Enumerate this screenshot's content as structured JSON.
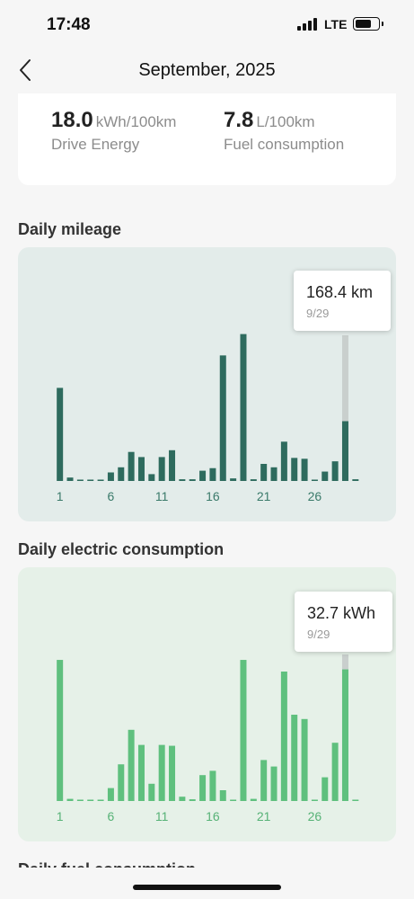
{
  "status_bar": {
    "time": "17:48",
    "network": "LTE"
  },
  "nav": {
    "title": "September, 2025",
    "back_icon": "chevron-left-icon"
  },
  "summary": {
    "drive_energy": {
      "value": "18.0",
      "unit": "kWh/100km",
      "label": "Drive Energy"
    },
    "fuel": {
      "value": "7.8",
      "unit": "L/100km",
      "label": "Fuel consumption"
    }
  },
  "sections": {
    "mileage_title": "Daily mileage",
    "electric_title": "Daily electric consumption",
    "fuel_title_partial": "Daily fuel consumption"
  },
  "colors": {
    "mileage_bar": "#2e6b5e",
    "mileage_bg": "#e3ecea",
    "electric_bar": "#5fc07e",
    "electric_bg": "#e6f1e8",
    "highlight": "#c9cfcd"
  },
  "chart_data": [
    {
      "type": "bar",
      "title": "Daily mileage",
      "categories": [
        "1",
        "2",
        "3",
        "4",
        "5",
        "6",
        "7",
        "8",
        "9",
        "10",
        "11",
        "12",
        "13",
        "14",
        "15",
        "16",
        "17",
        "18",
        "19",
        "20",
        "21",
        "22",
        "23",
        "24",
        "25",
        "26",
        "27",
        "28",
        "29",
        "30"
      ],
      "x_tick_labels": [
        "1",
        "6",
        "11",
        "16",
        "21",
        "26"
      ],
      "values": [
        109,
        4,
        1,
        1,
        1,
        10,
        16,
        34,
        28,
        8,
        28,
        36,
        2,
        2,
        12,
        15,
        147,
        3,
        172,
        2,
        20,
        16,
        46,
        27,
        26,
        1,
        11,
        23,
        70,
        2
      ],
      "ylim": [
        0,
        200
      ],
      "selected": {
        "index": 28,
        "value_label": "168.4 km",
        "date_label": "9/29"
      }
    },
    {
      "type": "bar",
      "title": "Daily electric consumption",
      "categories": [
        "1",
        "2",
        "3",
        "4",
        "5",
        "6",
        "7",
        "8",
        "9",
        "10",
        "11",
        "12",
        "13",
        "14",
        "15",
        "16",
        "17",
        "18",
        "19",
        "20",
        "21",
        "22",
        "23",
        "24",
        "25",
        "26",
        "27",
        "28",
        "29",
        "30"
      ],
      "x_tick_labels": [
        "1",
        "6",
        "11",
        "16",
        "21",
        "26"
      ],
      "values": [
        32.7,
        0.5,
        0.3,
        0.3,
        0.3,
        3.0,
        8.5,
        16.5,
        13.0,
        4.0,
        13.0,
        12.8,
        1.0,
        0.4,
        6.0,
        7.0,
        2.5,
        0.3,
        32.7,
        0.5,
        9.5,
        8.0,
        30.0,
        20.0,
        19.0,
        0.3,
        5.5,
        13.5,
        30.5,
        0.3
      ],
      "ylim": [
        0,
        40
      ],
      "selected": {
        "index": 28,
        "value_label": "32.7 kWh",
        "date_label": "9/29"
      }
    }
  ]
}
